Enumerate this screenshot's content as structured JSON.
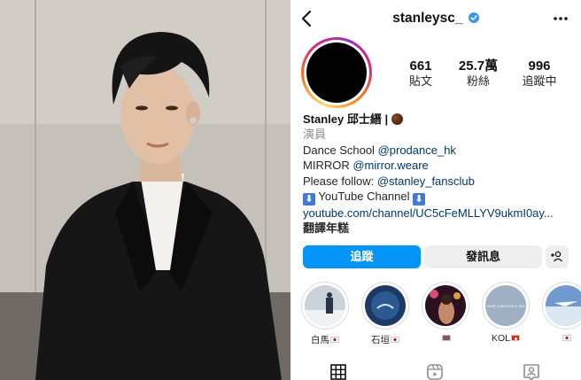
{
  "profile": {
    "username": "stanleysc_",
    "stats": [
      {
        "value": "661",
        "label": "貼文"
      },
      {
        "value": "25.7萬",
        "label": "粉絲"
      },
      {
        "value": "996",
        "label": "追蹤中"
      }
    ],
    "bio": {
      "name": "Stanley 邱士縉 |",
      "category": "演員",
      "line1_prefix": "Dance School ",
      "line1_link": "@prodance_hk",
      "line2_prefix": "MIRROR ",
      "line2_link": "@mirror.weare",
      "line3_prefix": "Please follow: ",
      "line3_link": "@stanley_fansclub",
      "youtube_text": "YouTube Channel",
      "youtube_arrow": "⬇",
      "url": "youtube.com/channel/UC5cFeMLLYV9ukmI0ay...",
      "translate": "翻譯年糕"
    }
  },
  "actions": {
    "follow_label": "追蹤",
    "message_label": "發訊息"
  },
  "highlights": [
    {
      "label": "白馬",
      "flag": "jp"
    },
    {
      "label": "石垣",
      "flag": "jp"
    },
    {
      "label": "",
      "flag": "th"
    },
    {
      "label": "KOL",
      "flag": "hk"
    },
    {
      "label": "",
      "flag": "jp"
    }
  ],
  "highlight_cover_text": "WHAT A BEAUTIFUL DAY",
  "icons": {
    "back": "chevron-left-icon",
    "verified": "verified-badge-icon",
    "more": "more-horizontal-icon",
    "suggest": "add-person-icon",
    "tabs": [
      "grid-icon",
      "reels-icon",
      "tagged-icon"
    ]
  },
  "colors": {
    "accent": "#0095f6",
    "verified": "#3897f0",
    "link": "#00376b",
    "secondary_text": "#8e8e8e",
    "button_gray": "#efefef"
  }
}
